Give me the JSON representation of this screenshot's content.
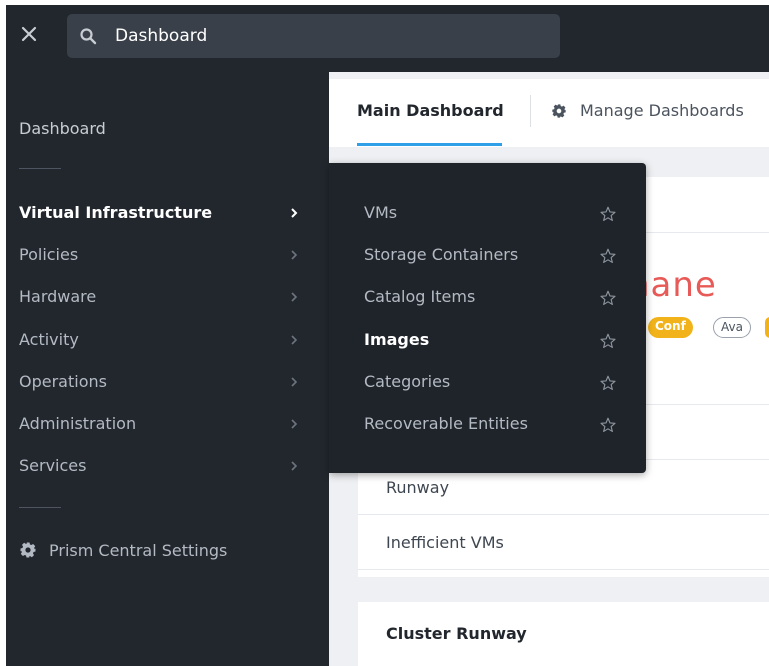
{
  "topbar": {
    "search": {
      "value": "Dashboard"
    }
  },
  "sidebar": {
    "dashboard_label": "Dashboard",
    "items": [
      {
        "label": "Virtual Infrastructure",
        "active": true
      },
      {
        "label": "Policies"
      },
      {
        "label": "Hardware"
      },
      {
        "label": "Activity"
      },
      {
        "label": "Operations"
      },
      {
        "label": "Administration"
      },
      {
        "label": "Services"
      }
    ],
    "settings_label": "Prism Central Settings"
  },
  "submenu": {
    "items": [
      {
        "label": "VMs"
      },
      {
        "label": "Storage Containers"
      },
      {
        "label": "Catalog Items"
      },
      {
        "label": "Images",
        "active": true
      },
      {
        "label": "Categories"
      },
      {
        "label": "Recoverable Entities"
      }
    ]
  },
  "main": {
    "tabs": {
      "main_dashboard": "Main Dashboard",
      "manage_dashboards": "Manage Dashboards"
    },
    "cluster_name_partial": "hane",
    "badges": {
      "conf": "Conf",
      "ava": "Ava"
    },
    "rows": [
      "Runway",
      "Inefficient VMs"
    ],
    "card2_title": "Cluster Runway"
  },
  "colors": {
    "nav_bg": "#22272e",
    "accent_blue": "#2f9fe8",
    "cluster_red": "#e85a57",
    "badge_yellow": "#f2b31a"
  }
}
